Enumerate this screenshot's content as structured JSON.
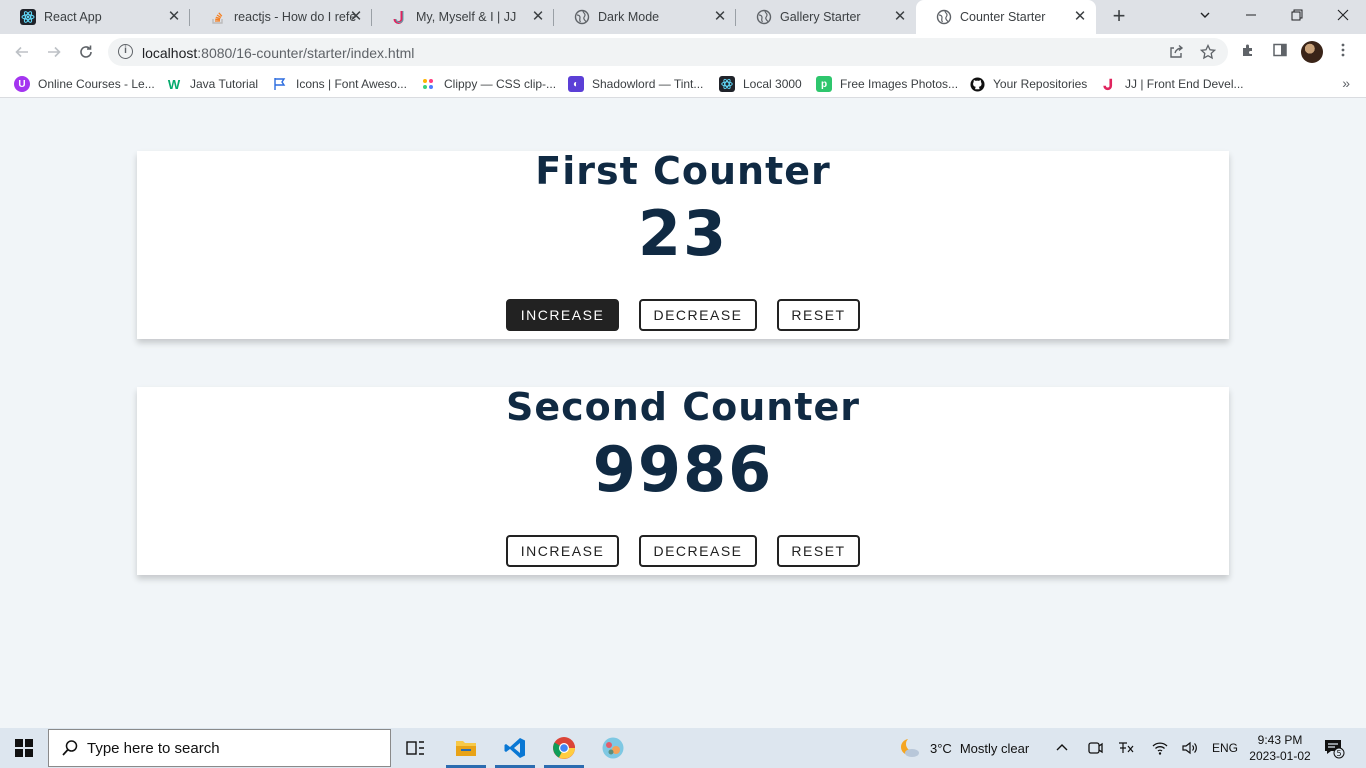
{
  "browser": {
    "tabs": [
      {
        "title": "React App",
        "icon": "react-icon",
        "active": false
      },
      {
        "title": "reactjs - How do I refe",
        "icon": "stackoverflow-icon",
        "active": false
      },
      {
        "title": "My, Myself & I | JJ",
        "icon": "jj-icon",
        "active": false
      },
      {
        "title": "Dark Mode",
        "icon": "globe-icon",
        "active": false
      },
      {
        "title": "Gallery Starter",
        "icon": "globe-icon",
        "active": false
      },
      {
        "title": "Counter Starter",
        "icon": "globe-icon",
        "active": true
      }
    ],
    "address": {
      "host": "localhost",
      "path": ":8080/16-counter/starter/index.html"
    },
    "bookmarks": [
      {
        "label": "Online Courses - Le...",
        "icon": "udemy-icon"
      },
      {
        "label": "Java Tutorial",
        "icon": "w3schools-icon"
      },
      {
        "label": "Icons | Font Aweso...",
        "icon": "flag-icon"
      },
      {
        "label": "Clippy — CSS clip-...",
        "icon": "clippy-icon"
      },
      {
        "label": "Shadowlord — Tint...",
        "icon": "shadowlord-icon"
      },
      {
        "label": "Local 3000",
        "icon": "react-icon"
      },
      {
        "label": "Free Images Photos...",
        "icon": "pixabay-icon"
      },
      {
        "label": "Your Repositories",
        "icon": "github-icon"
      },
      {
        "label": "JJ | Front End Devel...",
        "icon": "jj-icon"
      }
    ]
  },
  "counters": [
    {
      "title": "First Counter",
      "value": "23",
      "buttons": {
        "increase": "INCREASE",
        "decrease": "DECREASE",
        "reset": "RESET"
      },
      "highlighted": "increase"
    },
    {
      "title": "Second Counter",
      "value": "9986",
      "buttons": {
        "increase": "INCREASE",
        "decrease": "DECREASE",
        "reset": "RESET"
      },
      "highlighted": ""
    }
  ],
  "taskbar": {
    "search_placeholder": "Type here to search",
    "weather": {
      "temp": "3°C",
      "condition": "Mostly clear"
    },
    "language": "ENG",
    "time": "9:43 PM",
    "date": "2023-01-02",
    "notifications": "5"
  },
  "colors": {
    "page_bg": "#f1f5f8",
    "heading": "#102a43",
    "button_dark": "#222222"
  }
}
